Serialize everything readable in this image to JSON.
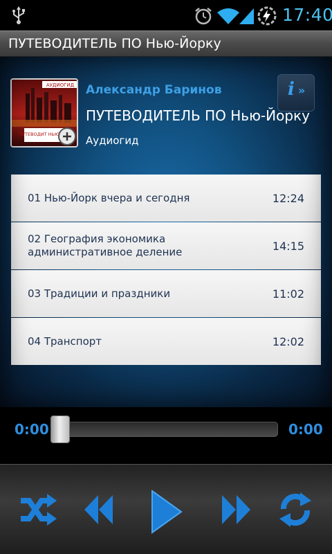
{
  "status_bar": {
    "time": "17:40",
    "icons": [
      "usb-icon",
      "alarm-icon",
      "wifi-icon",
      "signal-icon",
      "battery-charging-icon"
    ]
  },
  "header": {
    "title": "ПУТЕВОДИТЕЛЬ ПО Нью-Йорку"
  },
  "album": {
    "author": "Александр Баринов",
    "title": "ПУТЕВОДИТЕЛЬ ПО Нью-Йорку",
    "genre": "Аудиогид",
    "cover": {
      "brand": "АУДИОГИД",
      "label": "ПУТЕВОДИТ НЬЮ-ЙОРК"
    }
  },
  "info_button": {
    "icon": "info-icon"
  },
  "tracks": [
    {
      "name": "01 Нью-Йорк вчера и сегодня",
      "duration": "12:24"
    },
    {
      "name": "02 География экономика административное деление",
      "duration": "14:15"
    },
    {
      "name": "03 Традиции и праздники",
      "duration": "11:02"
    },
    {
      "name": "04 Транспорт",
      "duration": "12:02"
    }
  ],
  "player": {
    "current_time": "0:00",
    "total_time": "0:00",
    "progress": 0.0,
    "controls": [
      "shuffle-icon",
      "rewind-icon",
      "play-icon",
      "fast-forward-icon",
      "repeat-icon"
    ]
  },
  "colors": {
    "accent": "#3da0e6",
    "control_blue": "#2f8ede",
    "track_text": "#1e3252"
  }
}
